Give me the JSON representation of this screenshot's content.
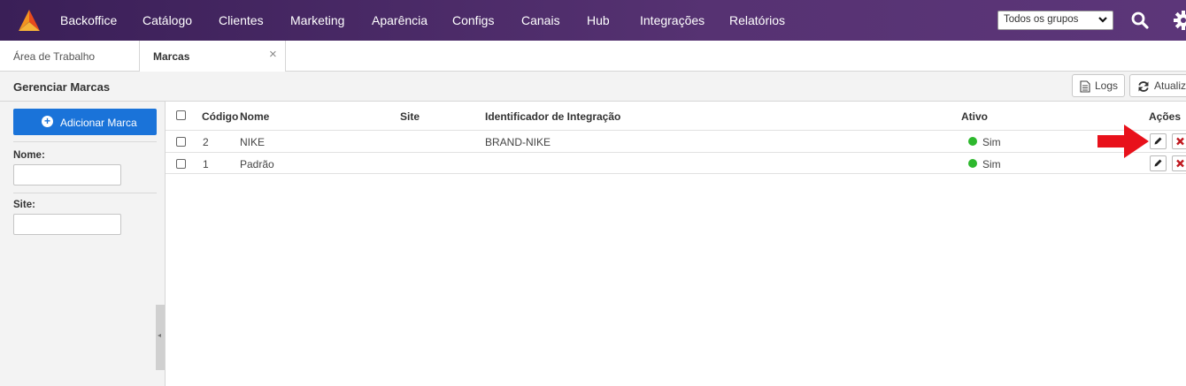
{
  "nav": {
    "items": [
      "Backoffice",
      "Catálogo",
      "Clientes",
      "Marketing",
      "Aparência",
      "Configs",
      "Canais",
      "Hub",
      "Integrações",
      "Relatórios"
    ],
    "group_select_value": "Todos os grupos"
  },
  "tabs": {
    "tab1": "Área de Trabalho",
    "tab2": "Marcas",
    "close": "×"
  },
  "page": {
    "title": "Gerenciar Marcas",
    "logs_label": "Logs",
    "refresh_label": "Atualizar"
  },
  "sidebar": {
    "add_label": "Adicionar Marca",
    "name_label": "Nome:",
    "site_label": "Site:",
    "collapse": "◂"
  },
  "table": {
    "headers": {
      "code": "Código",
      "name": "Nome",
      "site": "Site",
      "integration": "Identificador de Integração",
      "active": "Ativo",
      "actions": "Ações"
    },
    "rows": [
      {
        "code": "2",
        "name": "NIKE",
        "site": "",
        "integration": "BRAND-NIKE",
        "active": "Sim"
      },
      {
        "code": "1",
        "name": "Padrão",
        "site": "",
        "integration": "",
        "active": "Sim"
      }
    ]
  },
  "colors": {
    "nav_bg": "#563272",
    "primary": "#1a73d9",
    "active_dot": "#2db82d",
    "delete": "#c0181f",
    "arrow": "#e8111b"
  }
}
